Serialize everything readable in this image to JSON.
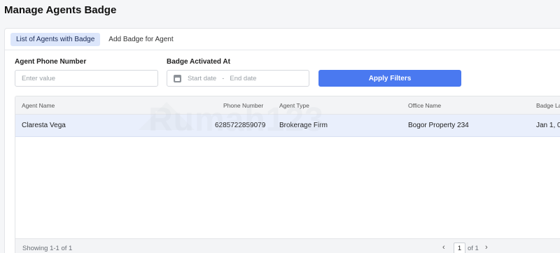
{
  "page": {
    "title": "Manage Agents Badge"
  },
  "tabs": [
    {
      "label": "List of Agents with Badge",
      "active": true
    },
    {
      "label": "Add Badge for Agent",
      "active": false
    }
  ],
  "filters": {
    "phone_label": "Agent Phone Number",
    "phone_placeholder": "Enter value",
    "badge_label": "Badge Activated At",
    "start_placeholder": "Start date",
    "date_separator": "-",
    "end_placeholder": "End date",
    "apply_label": "Apply Filters"
  },
  "table": {
    "columns": [
      "Agent Name",
      "Phone Number",
      "Agent Type",
      "Office Name",
      "Badge La"
    ],
    "rows": [
      [
        "Claresta Vega",
        "6285722859079",
        "Brokerage Firm",
        "Bogor Property 234",
        "Jan 1, 0"
      ]
    ],
    "watermark": "Rumah123"
  },
  "pagination": {
    "showing": "Showing 1-1 of 1",
    "prev": "‹",
    "page": "1",
    "of_text": "of 1",
    "next": "›"
  },
  "colors": {
    "accent": "#4a79f0",
    "selected_row": "#e9effc",
    "active_tab": "#dce6fb"
  }
}
